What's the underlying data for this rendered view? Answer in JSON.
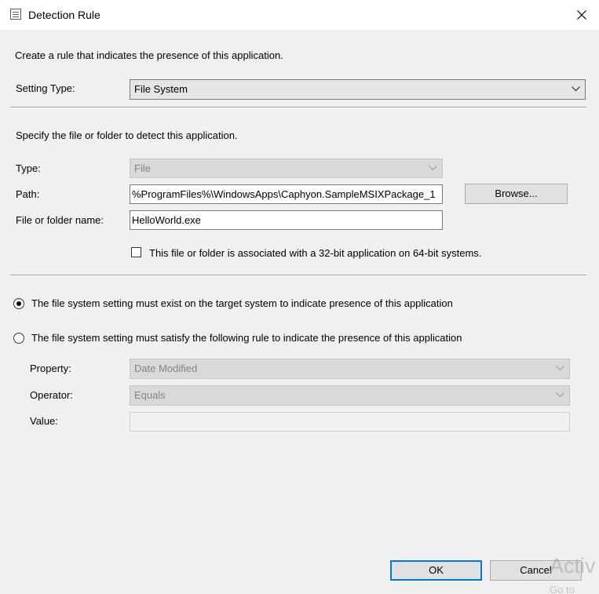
{
  "window": {
    "title": "Detection Rule",
    "icon": "rule-document-icon"
  },
  "intro": "Create a rule that indicates the presence of this application.",
  "setting_type": {
    "label": "Setting Type:",
    "value": "File System"
  },
  "detect_section": {
    "heading": "Specify the file or folder to detect this application.",
    "type_label": "Type:",
    "type_value": "File",
    "path_label": "Path:",
    "path_value": "%ProgramFiles%\\WindowsApps\\Caphyon.SampleMSIXPackage_1",
    "browse_label": "Browse...",
    "name_label": "File or folder name:",
    "name_value": "HelloWorld.exe",
    "checkbox_label": "This file or folder is associated with a 32-bit application on 64-bit systems.",
    "checkbox_checked": false
  },
  "options": {
    "must_exist_label": "The file system setting must exist on the target system to indicate presence of this application",
    "must_exist_selected": true,
    "satisfy_rule_label": "The file system setting must satisfy the following rule to indicate the presence of this application",
    "satisfy_rule_selected": false
  },
  "rule": {
    "property_label": "Property:",
    "property_value": "Date Modified",
    "operator_label": "Operator:",
    "operator_value": "Equals",
    "value_label": "Value:",
    "value_value": ""
  },
  "footer": {
    "ok_label": "OK",
    "cancel_label": "Cancel"
  },
  "watermark": {
    "line1": "Activ",
    "line2": "Go to"
  },
  "colors": {
    "accent": "#0078d7",
    "dialog_bg": "#f0f0f0",
    "disabled_field": "#d9d9d9"
  }
}
